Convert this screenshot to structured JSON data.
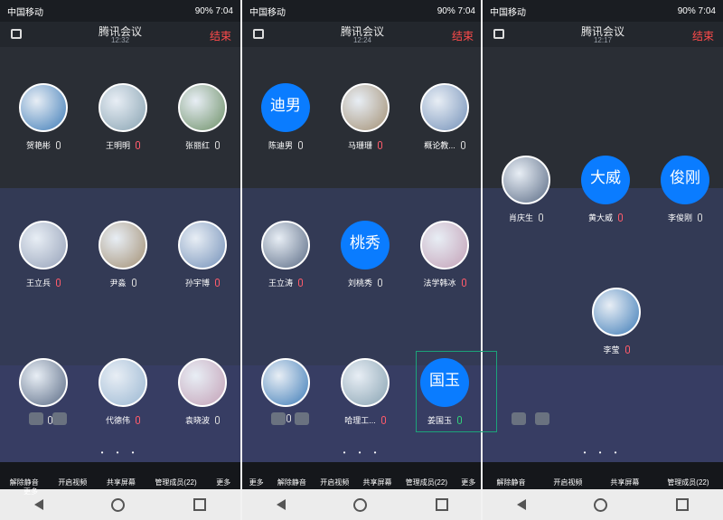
{
  "status_bar": {
    "carrier": "中国移动",
    "battery": "90%",
    "time": "7:04"
  },
  "panels": [
    {
      "title": "腾讯会议",
      "time": "12:32",
      "end": "结束",
      "rows": [
        [
          {
            "name": "贺艳彬",
            "avatar": "img"
          },
          {
            "name": "王明明",
            "avatar": "img"
          },
          {
            "name": "张丽红",
            "avatar": "img"
          }
        ],
        [
          {
            "name": "王立兵",
            "avatar": "img"
          },
          {
            "name": "尹淼",
            "avatar": "img"
          },
          {
            "name": "孙宇博",
            "avatar": "img"
          }
        ],
        [
          {
            "name": "孙",
            "avatar": "img"
          },
          {
            "name": "代德伟",
            "avatar": "img"
          },
          {
            "name": "袁晓波",
            "avatar": "img"
          }
        ]
      ],
      "toolbar": [
        "解除静音",
        "开启视频",
        "共享屏幕",
        "管理成员(22)",
        "更多"
      ]
    },
    {
      "title": "腾讯会议",
      "time": "12:24",
      "end": "结束",
      "rows": [
        [
          {
            "name": "陈迪男",
            "avatar": "迪男"
          },
          {
            "name": "马珊珊",
            "avatar": "img"
          },
          {
            "name": "概论教...",
            "avatar": "img"
          }
        ],
        [
          {
            "name": "王立涛",
            "avatar": "img"
          },
          {
            "name": "刘桃秀",
            "avatar": "桃秀"
          },
          {
            "name": "法学韩冰",
            "avatar": "img"
          }
        ],
        [
          {
            "name": "",
            "avatar": "img"
          },
          {
            "name": "哈理工...",
            "avatar": "img"
          },
          {
            "name": "姜国玉",
            "avatar": "国玉"
          }
        ]
      ],
      "toolbar": [
        "更多",
        "解除静音",
        "开启视频",
        "共享屏幕",
        "管理成员(22)",
        "更多"
      ]
    },
    {
      "title": "腾讯会议",
      "time": "12:17",
      "end": "结束",
      "rows": [
        [
          {
            "name": "肖庆生",
            "avatar": "img"
          },
          {
            "name": "黄大威",
            "avatar": "大威"
          },
          {
            "name": "李俊刚",
            "avatar": "俊刚"
          }
        ],
        [
          {
            "name": "李莹",
            "avatar": "img"
          }
        ]
      ],
      "toolbar": [
        "解除静音",
        "开启视频",
        "共享屏幕",
        "管理成员(22)"
      ]
    }
  ],
  "more": "更多"
}
